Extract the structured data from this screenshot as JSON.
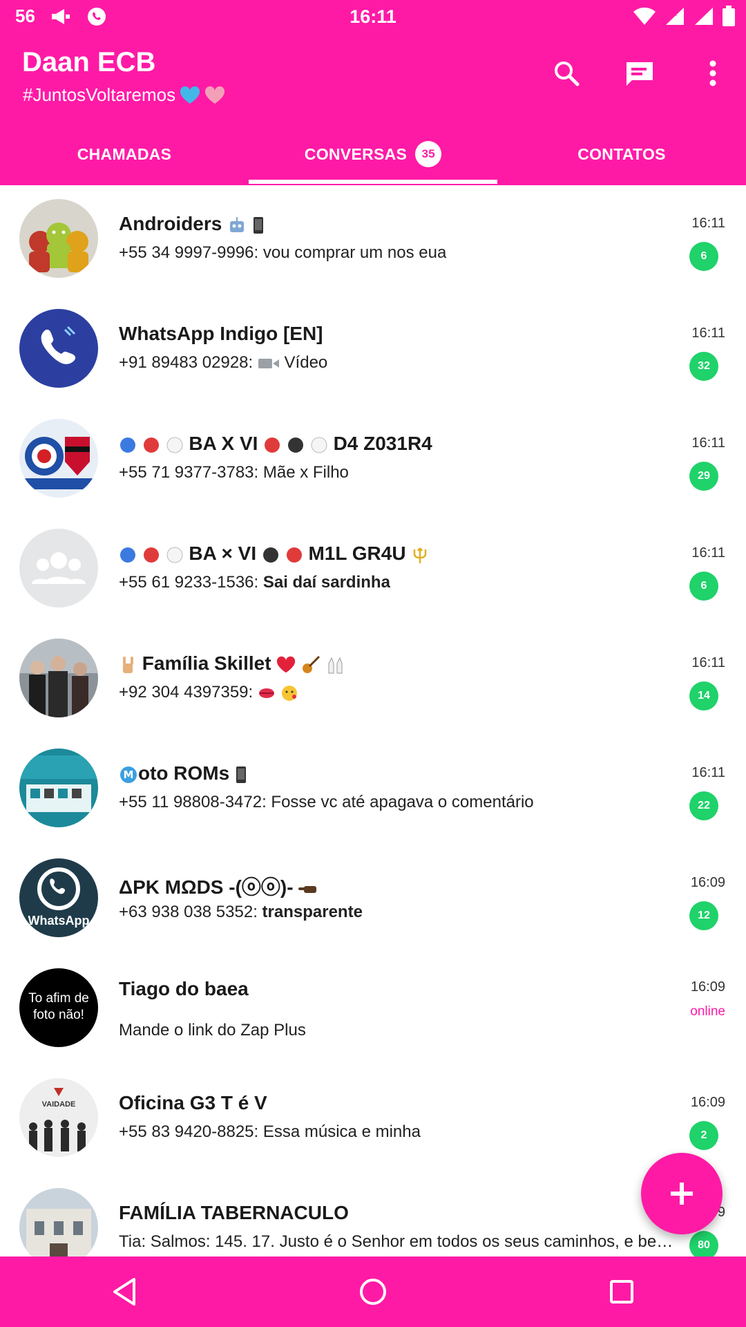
{
  "status_bar": {
    "signal_number": "56",
    "time": "16:11"
  },
  "app_bar": {
    "title": "Daan ECB",
    "subtitle": "#JuntosVoltaremos",
    "accent": "#ff1aa6"
  },
  "tabs": [
    {
      "label": "CHAMADAS"
    },
    {
      "label": "CONVERSAS",
      "badge": "35",
      "selected": true
    },
    {
      "label": "CONTATOS"
    }
  ],
  "chats": [
    {
      "name": "Androiders",
      "sender": "+55 34 9997-9996:",
      "message": "vou comprar um nos eua",
      "time": "16:11",
      "unread": "6"
    },
    {
      "name": "WhatsApp Indigo [EN]",
      "sender": "+91 89483 02928:",
      "message": "Vídeo",
      "time": "16:11",
      "unread": "32"
    },
    {
      "name": "BA X VI",
      "name_suffix": "D4 Z031R4",
      "sender": "+55 71 9377-3783:",
      "message": "Mãe x Filho",
      "time": "16:11",
      "unread": "29"
    },
    {
      "name": "BA × VI",
      "name_suffix": "M1L GR4U",
      "sender": "+55 61 9233-1536:",
      "message": "Sai daí sardinha",
      "time": "16:11",
      "unread": "6"
    },
    {
      "name": "Família Skillet",
      "sender": "+92 304 4397359:",
      "message": "",
      "time": "16:11",
      "unread": "14"
    },
    {
      "name": "oto ROMs",
      "sender": "+55 11 98808-3472:",
      "message": "Fosse vc até apagava o comentário",
      "time": "16:11",
      "unread": "22"
    },
    {
      "name": "ΔPK MΩDS",
      "name_suffix": "-(ⓞⓞ)-",
      "sender": "+63 938 038 5352:",
      "message": "transparente",
      "time": "16:09",
      "unread": "12"
    },
    {
      "name": "Tiago do baea",
      "message": "Mande o link do Zap Plus",
      "time": "16:09",
      "status": "online",
      "avatar_text": "To afim de foto não!"
    },
    {
      "name": "Oficina G3 T é V",
      "sender": "+55 83 9420-8825:",
      "message": "Essa música e minha",
      "time": "16:09",
      "unread": "2",
      "avatar_text": "VAIDADE"
    },
    {
      "name": "FAMÍLIA TABERNACULO",
      "sender": "Tia:",
      "message": "Salmos: 145. 17. Justo é o Senhor em todos os seus caminhos, e ben...",
      "time": "16:09",
      "unread": "80"
    }
  ],
  "avatar_labels": {
    "whatsapp": "WhatsApp"
  }
}
